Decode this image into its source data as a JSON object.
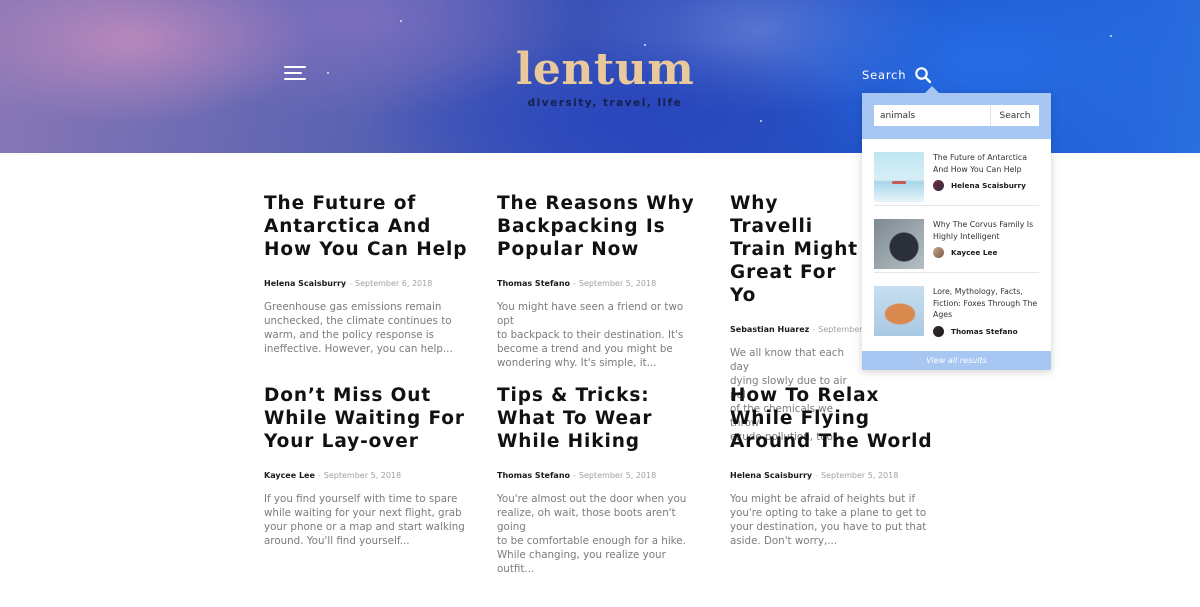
{
  "header": {
    "logo_main": "lentum",
    "tagline": "diversity, travel, life",
    "search_label": "Search"
  },
  "search_dropdown": {
    "input_value": "animals",
    "button_label": "Search",
    "results": [
      {
        "title": "The Future of Antarctica And How You Can Help",
        "author": "Helena Scaisburry"
      },
      {
        "title": "Why The Corvus Family Is Highly Intelligent",
        "author": "Kaycee Lee"
      },
      {
        "title": "Lore, Mythology, Facts, Fiction: Foxes Through The Ages",
        "author": "Thomas Stefano"
      }
    ],
    "footer_label": "View all results"
  },
  "posts": [
    {
      "title": "The Future of\nAntarctica And\nHow You Can Help",
      "author": "Helena Scaisburry",
      "date": "September 6, 2018",
      "excerpt": "Greenhouse gas emissions remain\nunchecked, the climate continues to\nwarm, and the policy response is\nineffective. However, you can help..."
    },
    {
      "title": "The Reasons Why\nBackpacking Is\nPopular Now",
      "author": "Thomas Stefano",
      "date": "September 5, 2018",
      "excerpt": "You might have seen a friend or two opt\nto backpack to their destination. It's\nbecome a trend and you might be\nwondering why. It's simple, it..."
    },
    {
      "title": "Why Travelli\nTrain Might\nGreat For Yo",
      "author": "Sebastian Huarez",
      "date": "September 5,",
      "excerpt": "We all know that each day\ndying slowly due to air pol\nof the chemicals we throw\nexude pollution, too,..."
    },
    {
      "title": "Don’t Miss Out\nWhile Waiting For\nYour Lay-over",
      "author": "Kaycee Lee",
      "date": "September 5, 2018",
      "excerpt": "If you find yourself with time to spare\nwhile waiting for your next flight, grab\nyour phone or a map and start walking\naround. You'll find yourself..."
    },
    {
      "title": "Tips & Tricks:\nWhat To Wear\nWhile Hiking",
      "author": "Thomas Stefano",
      "date": "September 5, 2018",
      "excerpt": "You're almost out the door when you\nrealize, oh wait, those boots aren't going\nto be comfortable enough for a hike.\nWhile changing, you realize your outfit..."
    },
    {
      "title": "How To Relax\nWhile Flying\nAround The World",
      "author": "Helena Scaisburry",
      "date": "September 5, 2018",
      "excerpt": "You might be afraid of heights but if\nyou're opting to take a plane to get to\nyour destination, you have to put that\naside. Don't worry,..."
    }
  ],
  "meta_separator": "-"
}
